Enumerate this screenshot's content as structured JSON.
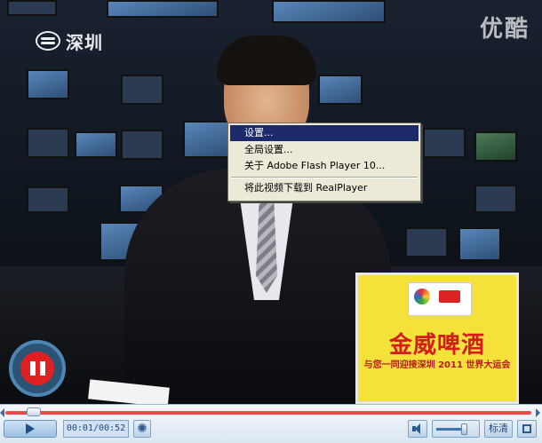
{
  "video": {
    "channel_logo_text": "深圳",
    "watermark": "优酷",
    "sign_title": "金威啤酒",
    "sign_subtitle": "与您一同迎接深圳 2011 世界大运会"
  },
  "context_menu": {
    "items": [
      {
        "label": "设置..."
      },
      {
        "label": "全局设置..."
      },
      {
        "label": "关于 Adobe Flash Player 10..."
      },
      {
        "label": "将此视频下载到 RealPlayer"
      }
    ]
  },
  "controls": {
    "progress": 0.02,
    "time": "00:01/00:52",
    "volume_level": 0.7,
    "quality_label": "标清",
    "icons": {
      "play": "play-icon",
      "settings": "gear-icon",
      "volume": "speaker-icon",
      "fullscreen": "fullscreen-icon",
      "pause": "pause-icon"
    }
  }
}
